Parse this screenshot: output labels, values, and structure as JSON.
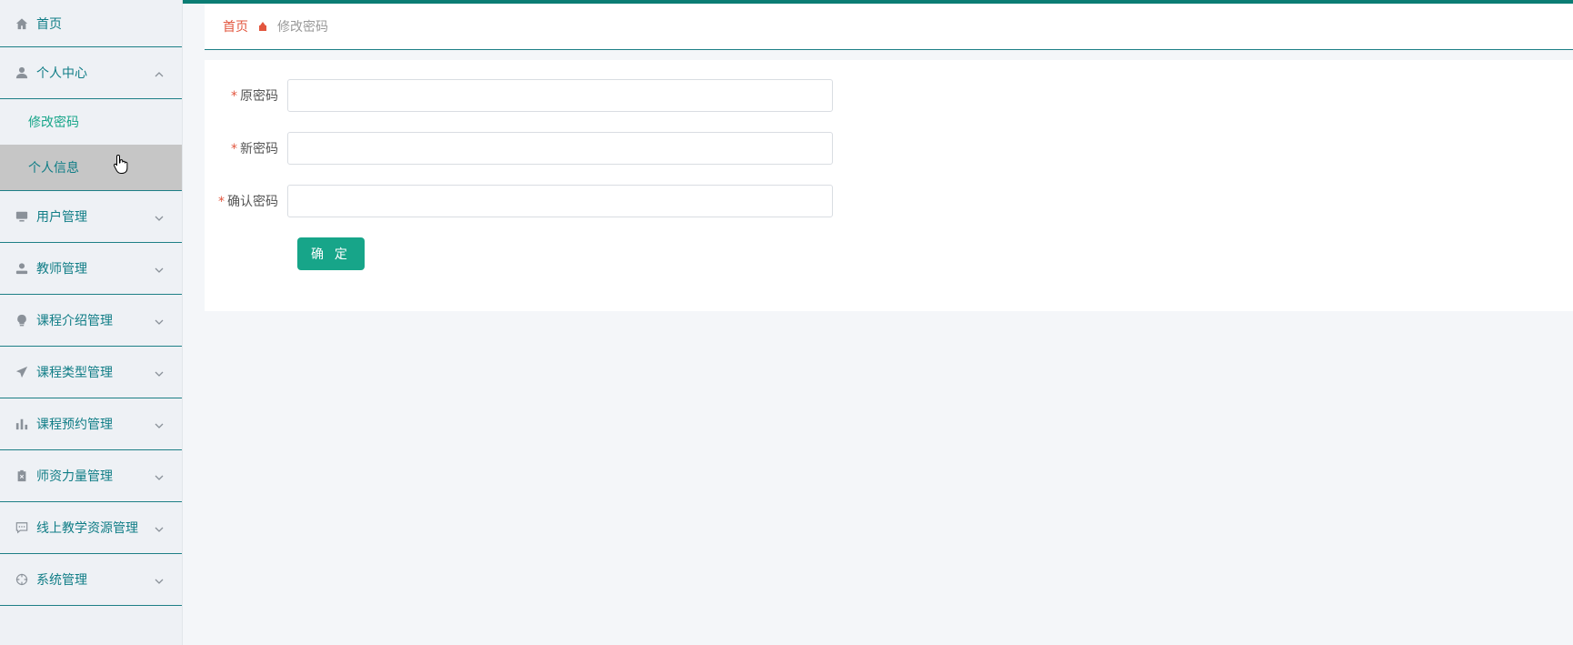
{
  "sidebar": {
    "items": [
      {
        "label": "首页",
        "icon": "home-icon"
      },
      {
        "label": "个人中心",
        "icon": "user-icon",
        "expanded": true,
        "children": [
          {
            "label": "修改密码",
            "active": true
          },
          {
            "label": "个人信息",
            "hover": true
          }
        ]
      },
      {
        "label": "用户管理",
        "icon": "monitor-icon"
      },
      {
        "label": "教师管理",
        "icon": "teacher-icon"
      },
      {
        "label": "课程介绍管理",
        "icon": "bulb-icon"
      },
      {
        "label": "课程类型管理",
        "icon": "send-icon"
      },
      {
        "label": "课程预约管理",
        "icon": "bar-chart-icon"
      },
      {
        "label": "师资力量管理",
        "icon": "clipboard-icon"
      },
      {
        "label": "线上教学资源管理",
        "icon": "chat-icon"
      },
      {
        "label": "系统管理",
        "icon": "crosshair-icon"
      }
    ]
  },
  "breadcrumb": {
    "home": "首页",
    "current": "修改密码"
  },
  "form": {
    "fields": [
      {
        "label": "原密码",
        "required": true,
        "value": ""
      },
      {
        "label": "新密码",
        "required": true,
        "value": ""
      },
      {
        "label": "确认密码",
        "required": true,
        "value": ""
      }
    ],
    "submit_label": "确 定"
  },
  "colors": {
    "accent": "#0b7d74",
    "primary_button": "#17a589",
    "breadcrumb_home": "#e2563e",
    "required": "#e2563e"
  }
}
